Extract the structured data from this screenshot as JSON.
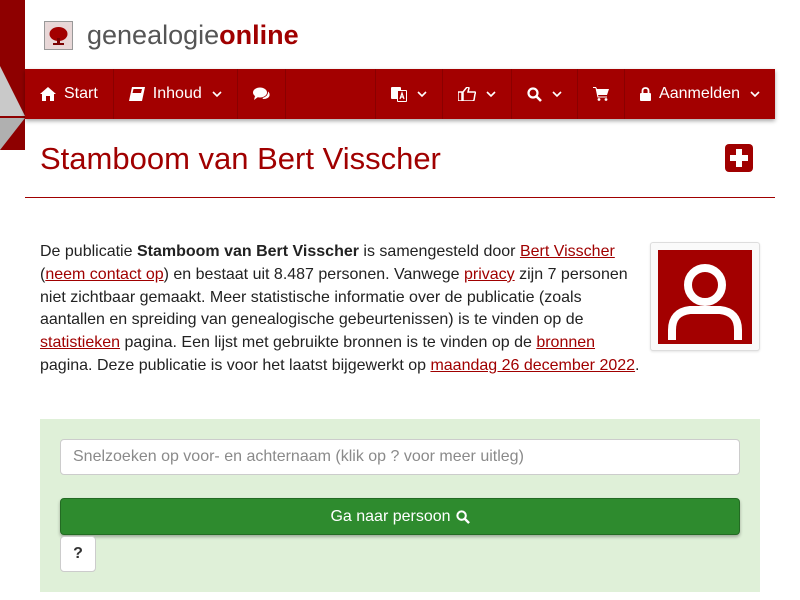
{
  "brand": {
    "name_part1": "genealogie",
    "name_part2": "online",
    "logo_icon": "tree-icon"
  },
  "colors": {
    "brand_red": "#a30000",
    "panel_green": "#dff0d8",
    "button_green": "#2e8b2e"
  },
  "navbar": {
    "start_label": "Start",
    "inhoud_label": "Inhoud",
    "login_label": "Aanmelden",
    "icons": [
      "home-icon",
      "book-icon",
      "comments-icon",
      "language-icon",
      "thumbs-icon",
      "search-icon",
      "cart-icon",
      "lock-icon"
    ]
  },
  "page": {
    "title": "Stamboom van Bert Visscher"
  },
  "intro": {
    "t1": "De publicatie ",
    "pub_name": "Stamboom van Bert Visscher",
    "t2": " is samengesteld door ",
    "author_link": "Bert Visscher",
    "t3": " (",
    "contact_link": "neem contact op",
    "t4": ") en bestaat uit 8.487 personen. Vanwege ",
    "privacy_link": "privacy",
    "t5": " zijn 7 personen niet zichtbaar gemaakt. Meer statistische informatie over de publicatie (zoals aantallen en spreiding van genealogische gebeurtenissen) is te vinden op de ",
    "stats_link": "statistieken",
    "t6": " pagina. Een lijst met gebruikte bronnen is te vinden op de ",
    "sources_link": "bronnen",
    "t7": " pagina. Deze publicatie is voor het laatst bijgewerkt op ",
    "date_link": "maandag 26 december 2022",
    "t8": "."
  },
  "search": {
    "placeholder": "Snelzoeken op voor- en achternaam (klik op ? voor meer uitleg)",
    "value": "",
    "go_label": "Ga naar persoon",
    "help_label": "?"
  }
}
